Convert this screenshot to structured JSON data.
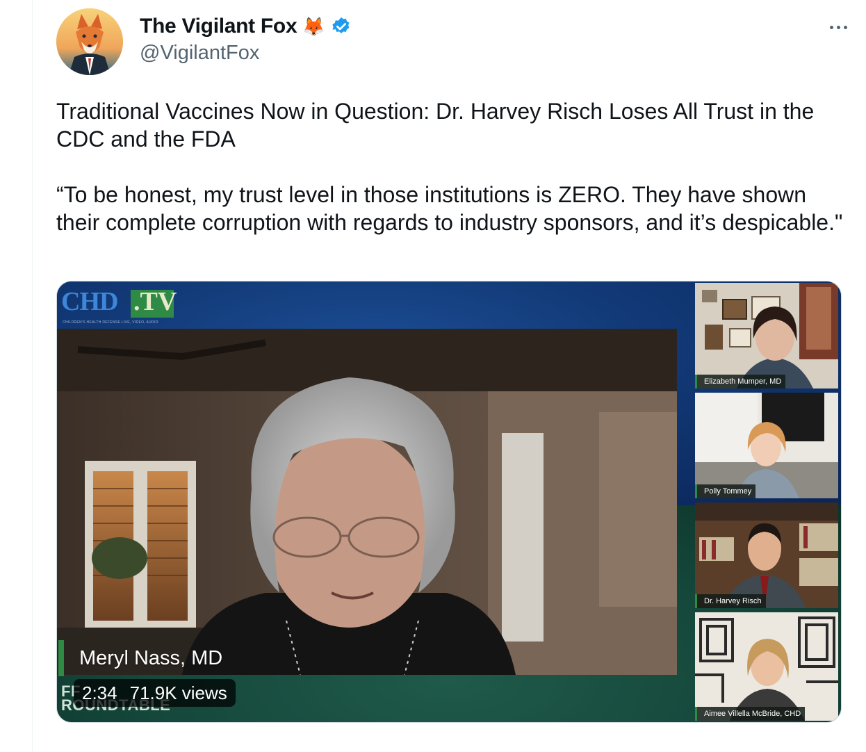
{
  "author": {
    "display_name": "The Vigilant Fox",
    "emoji": "🦊",
    "verified": true,
    "handle": "@VigilantFox",
    "avatar_icon": "fox-in-suit-icon"
  },
  "tweet": {
    "paragraph1": "Traditional Vaccines Now in Question: Dr. Harvey Risch Loses All Trust in the CDC and the FDA",
    "paragraph2": "“To be honest, my trust level in those institutions is ZERO. They have shown their complete corruption with regards to industry sponsors, and it’s despicable.\""
  },
  "video": {
    "logo_chd": "CHD",
    "logo_tv": ".TV",
    "logo_sub": "CHILDREN'S HEALTH DEFENSE   LIVE, VIDEO, AUDIO",
    "main_speaker": "Meryl Nass, MD",
    "roundtable_text": "FF\nROUNDTABLE",
    "duration": "2:34",
    "views": "71.9K views",
    "participants": [
      "Elizabeth Mumper, MD",
      "Polly Tommey",
      "Dr. Harvey Risch",
      "Aimee Villella McBride, CHD"
    ]
  },
  "colors": {
    "verified_blue": "#1d9bf0",
    "text_primary": "#0f1419",
    "text_secondary": "#536471",
    "chd_green": "#2f8a45"
  }
}
